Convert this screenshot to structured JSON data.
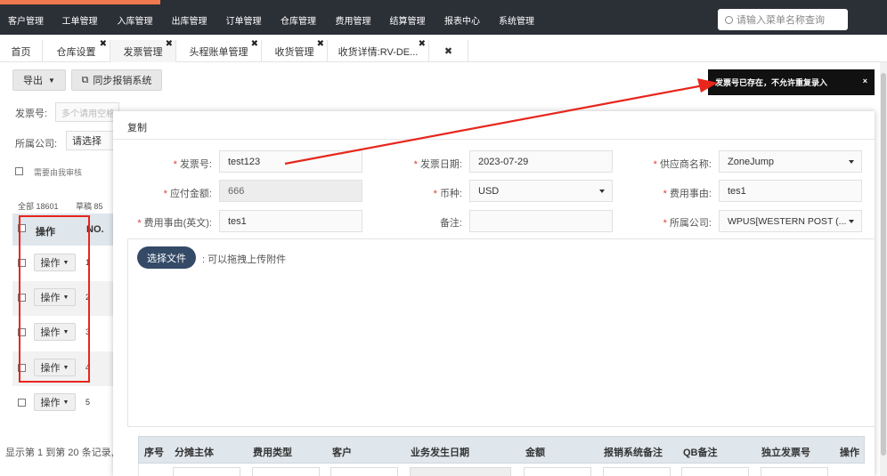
{
  "nav": {
    "menu": [
      "客户管理",
      "工单管理",
      "入库管理",
      "出库管理",
      "订单管理",
      "仓库管理",
      "费用管理",
      "结算管理",
      "报表中心",
      "系统管理"
    ],
    "search_placeholder": "请输入菜单名称查询"
  },
  "tabs": [
    {
      "label": "首页"
    },
    {
      "label": "仓库设置"
    },
    {
      "label": "发票管理"
    },
    {
      "label": "头程账单管理"
    },
    {
      "label": "收货管理"
    },
    {
      "label": "收货详情:RV-DE..."
    }
  ],
  "toolbar": {
    "export_label": "导出",
    "sync_label": "同步报销系统"
  },
  "filters": {
    "invoice_no_label": "发票号:",
    "invoice_no_placeholder": "多个请用空格",
    "company_label": "所属公司:",
    "company_select": "请选择",
    "approve_label": "需要由我审核"
  },
  "list": {
    "count_all": "全部 18601",
    "count_draft": "草稿 85",
    "col_action": "操作",
    "col_no": "NO.",
    "rows": [
      {
        "action": "操作",
        "no": "1"
      },
      {
        "action": "操作",
        "no": "2"
      },
      {
        "action": "操作",
        "no": "3"
      },
      {
        "action": "操作",
        "no": "4"
      },
      {
        "action": "操作",
        "no": "5"
      }
    ],
    "footer": "显示第 1 到第 20 条记录,"
  },
  "modal": {
    "title": "复制",
    "fields": {
      "invoice_no": {
        "label": "发票号:",
        "value": "test123"
      },
      "invoice_date": {
        "label": "发票日期:",
        "value": "2023-07-29"
      },
      "supplier": {
        "label": "供应商名称:",
        "value": "ZoneJump"
      },
      "amount": {
        "label": "应付金额:",
        "value": "666"
      },
      "currency": {
        "label": "币种:",
        "value": "USD"
      },
      "fee_reason": {
        "label": "费用事由:",
        "value": "tes1"
      },
      "fee_reason_en": {
        "label": "费用事由(英文):",
        "value": "tes1"
      },
      "remark": {
        "label": "备注:",
        "value": ""
      },
      "company": {
        "label": "所属公司:",
        "value": "WPUS[WESTERN POST (..."
      }
    },
    "upload_button": "选择文件",
    "upload_hint": ": 可以拖拽上传附件",
    "table_headers": [
      "序号",
      "分摊主体",
      "费用类型",
      "客户",
      "业务发生日期",
      "金额",
      "报销系统备注",
      "QB备注",
      "独立发票号",
      "操作"
    ]
  },
  "toast": {
    "message": "发票号已存在，不允许重复录入",
    "close": "×"
  },
  "colors": {
    "accent": "#f0784e",
    "nav_bg": "#2b2f36",
    "primary": "#344a66",
    "required": "#e13a2e",
    "annotation_red": "#e8261c"
  }
}
